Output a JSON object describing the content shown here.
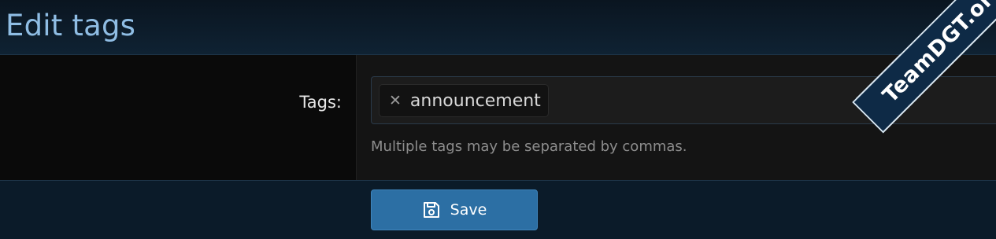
{
  "header": {
    "title": "Edit tags"
  },
  "form": {
    "tags_label": "Tags:",
    "tags": [
      {
        "label": "announcement"
      }
    ],
    "hint": "Multiple tags may be separated by commas."
  },
  "footer": {
    "save_label": "Save"
  },
  "watermark": {
    "text": "TeamDGT.org"
  },
  "icons": {
    "remove_tag": "close-icon",
    "save": "floppy-disk-icon"
  },
  "colors": {
    "title": "#8fbde4",
    "save_button": "#2c6fa4",
    "background": "#0c1a27"
  }
}
